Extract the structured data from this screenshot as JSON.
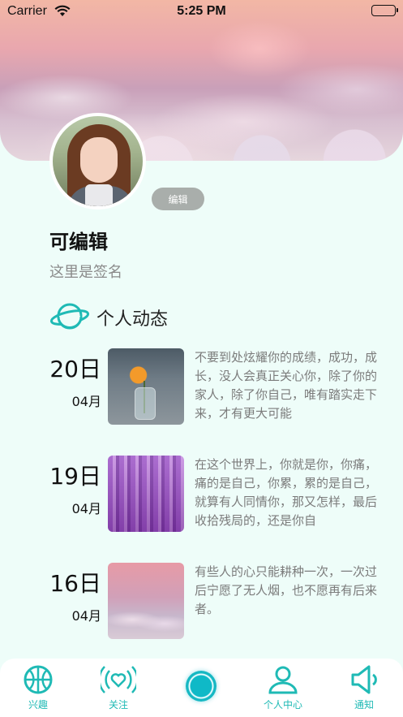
{
  "status_bar": {
    "carrier": "Carrier",
    "time": "5:25 PM"
  },
  "profile": {
    "edit_label": "编辑",
    "name": "可编辑",
    "signature": "这里是签名"
  },
  "section": {
    "title": "个人动态",
    "icon": "planet-icon"
  },
  "posts": [
    {
      "day": "20日",
      "month": "04月",
      "image": "orange-flower-in-vase",
      "text": "不要到处炫耀你的成绩，成功，成长，没人会真正关心你，除了你的家人，除了你自己，唯有踏实走下来，才有更大可能"
    },
    {
      "day": "19日",
      "month": "04月",
      "image": "lavender-field",
      "text": "在这个世界上，你就是你，你痛，痛的是自己，你累，累的是自己，就算有人同情你，那又怎样，最后收拾残局的，还是你自"
    },
    {
      "day": "16日",
      "month": "04月",
      "image": "sunset-clouds",
      "text": "有些人的心只能耕种一次，一次过后宁愿了无人烟，也不愿再有后来者。"
    }
  ],
  "tabbar": {
    "accent": "#1fbab5",
    "items": [
      {
        "label": "兴趣",
        "icon": "basketball-icon"
      },
      {
        "label": "关注",
        "icon": "heart-broadcast-icon"
      },
      {
        "label": "",
        "icon": "center-circle-icon"
      },
      {
        "label": "个人中心",
        "icon": "person-icon"
      },
      {
        "label": "通知",
        "icon": "speaker-icon"
      }
    ]
  }
}
